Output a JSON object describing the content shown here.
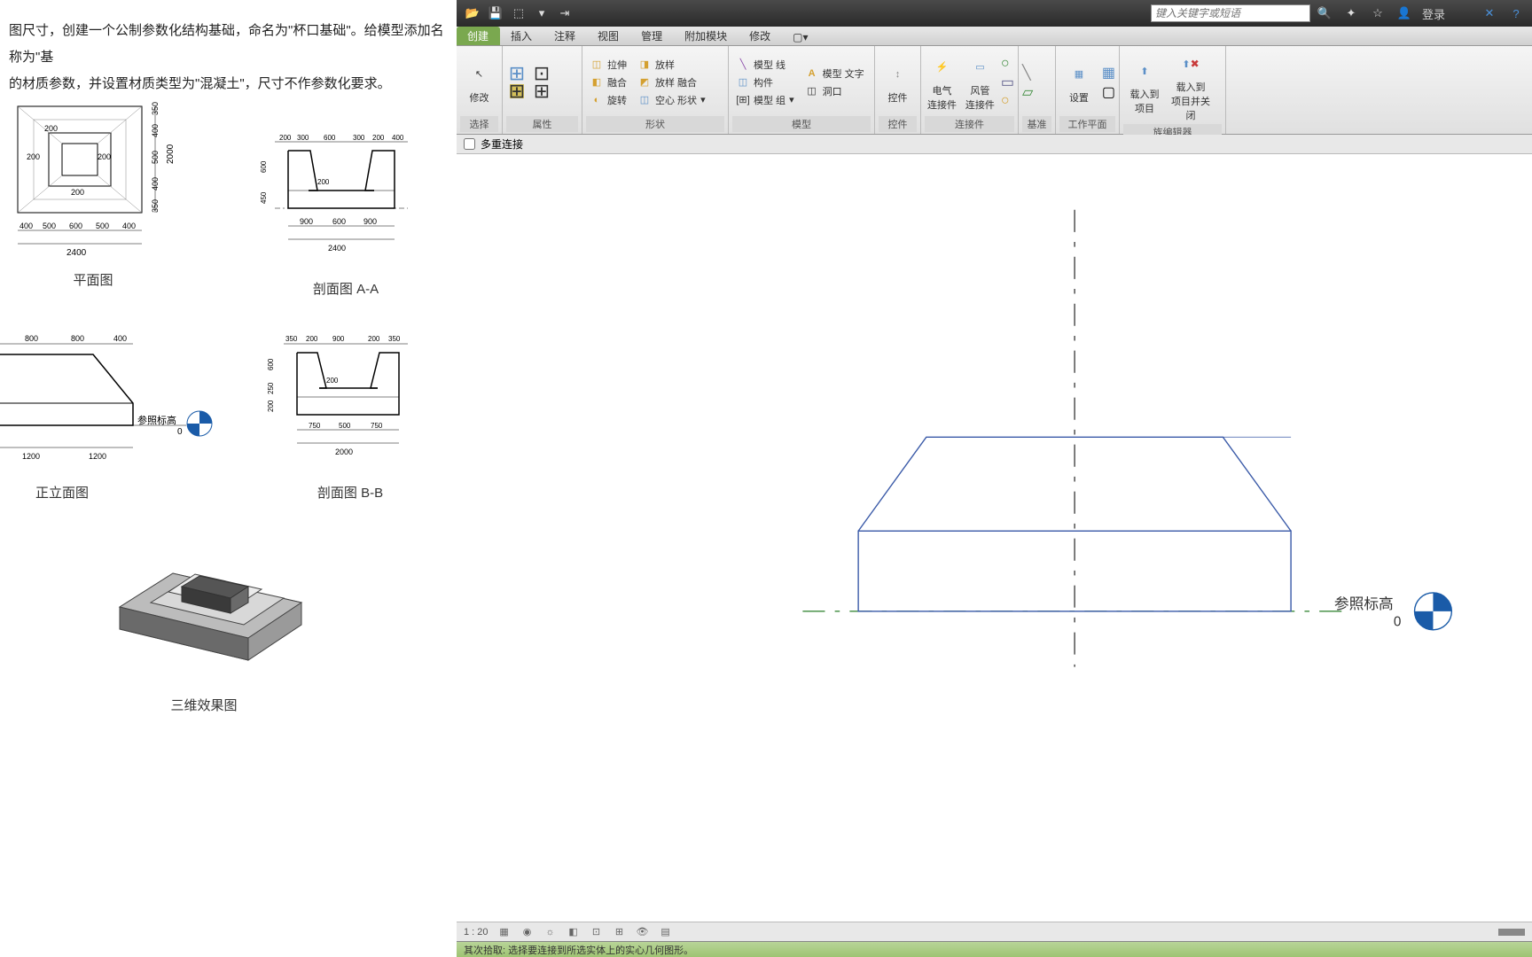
{
  "task": {
    "line1": "图尺寸，创建一个公制参数化结构基础，命名为\"杯口基础\"。给模型添加名称为\"基",
    "line2": "的材质参数，并设置材质类型为\"混凝土\"，尺寸不作参数化要求。"
  },
  "diagrams": {
    "plan": "平面图",
    "front": "正立面图",
    "secAA": "剖面图 A-A",
    "secBB": "剖面图 B-B",
    "threeD": "三维效果图",
    "ref_level": "参照标高",
    "ref_level_val": "0"
  },
  "plan_dims": {
    "outer_w": "2400",
    "outer_h": "2000",
    "bottom": [
      "400",
      "500",
      "600",
      "500",
      "400"
    ],
    "right": [
      "350",
      "400",
      "500",
      "400",
      "350"
    ],
    "inner": [
      "200",
      "200",
      "200",
      "200"
    ]
  },
  "secAA_dims": {
    "top": [
      "200",
      "300",
      "600",
      "300",
      "200",
      "400"
    ],
    "bottom": [
      "900",
      "600",
      "900"
    ],
    "total": "2400",
    "left": [
      "600",
      "450"
    ],
    "inner": "200"
  },
  "front_dims": {
    "top": [
      "800",
      "800",
      "400"
    ],
    "bottom": [
      "1200",
      "1200"
    ]
  },
  "secBB_dims": {
    "top": [
      "350",
      "200",
      "900",
      "200",
      "350"
    ],
    "bottom": [
      "750",
      "500",
      "750"
    ],
    "total": "2000",
    "left": [
      "600",
      "250",
      "200"
    ],
    "inner": "200"
  },
  "qat": {
    "search_ph": "键入关键字或短语",
    "login": "登录"
  },
  "tabs": [
    "创建",
    "插入",
    "注释",
    "视图",
    "管理",
    "附加模块",
    "修改"
  ],
  "ribbon": {
    "select": {
      "modify": "修改",
      "title": "选择"
    },
    "props": {
      "title": "属性"
    },
    "shapes": {
      "extrude": "拉伸",
      "sweep": "放样",
      "blend": "融合",
      "sweep_blend": "放样 融合",
      "revolve": "旋转",
      "void": "空心 形状",
      "title": "形状"
    },
    "model": {
      "model_line": "模型 线",
      "model_text": "模型 文字",
      "component": "构件",
      "opening": "洞口",
      "model_group": "模型 组",
      "title": "模型"
    },
    "controls": {
      "control": "控件",
      "title": "控件"
    },
    "connectors": {
      "elec": "电气\n连接件",
      "duct": "风管\n连接件",
      "title": "连接件"
    },
    "datum": {
      "title": "基准"
    },
    "workplane": {
      "set": "设置",
      "title": "工作平面"
    },
    "editor": {
      "load": "载入到\n项目",
      "load_close": "载入到\n项目并关闭",
      "title": "族编辑器"
    }
  },
  "options": {
    "multi": "多重连接"
  },
  "canvas": {
    "ref_level": "参照标高",
    "ref_level_val": "0"
  },
  "viewbar": {
    "scale": "1 : 20"
  },
  "status": "其次拾取: 选择要连接到所选实体上的实心几何图形。"
}
